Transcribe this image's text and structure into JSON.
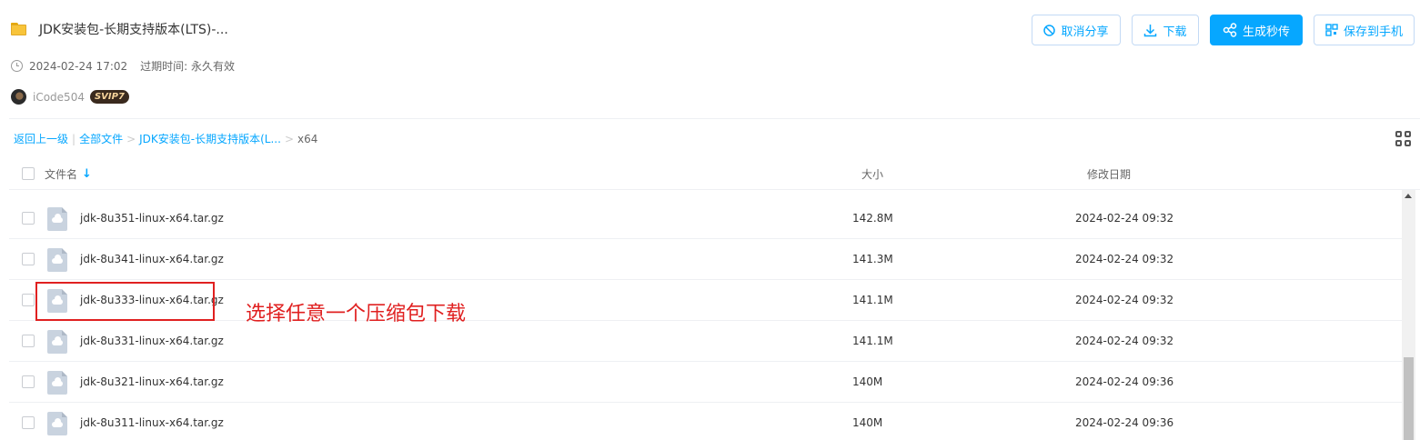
{
  "share": {
    "title": "JDK安装包-长期支持版本(LTS)-...",
    "datetime": "2024-02-24 17:02",
    "expire_label": "过期时间: 永久有效",
    "username": "iCode504",
    "vip": "SVIP7"
  },
  "actions": {
    "cancel_share": "取消分享",
    "download": "下载",
    "generate": "生成秒传",
    "save_phone": "保存到手机"
  },
  "breadcrumb": {
    "back": "返回上一级",
    "all_files": "全部文件",
    "folder": "JDK安装包-长期支持版本(L...",
    "current": "x64"
  },
  "table": {
    "col_name": "文件名",
    "col_size": "大小",
    "col_date": "修改日期",
    "rows": [
      {
        "name": "jdk-8u351-linux-x64.tar.gz",
        "size": "142.8M",
        "date": "2024-02-24 09:32"
      },
      {
        "name": "jdk-8u341-linux-x64.tar.gz",
        "size": "141.3M",
        "date": "2024-02-24 09:32"
      },
      {
        "name": "jdk-8u333-linux-x64.tar.gz",
        "size": "141.1M",
        "date": "2024-02-24 09:32"
      },
      {
        "name": "jdk-8u331-linux-x64.tar.gz",
        "size": "141.1M",
        "date": "2024-02-24 09:32"
      },
      {
        "name": "jdk-8u321-linux-x64.tar.gz",
        "size": "140M",
        "date": "2024-02-24 09:36"
      },
      {
        "name": "jdk-8u311-linux-x64.tar.gz",
        "size": "140M",
        "date": "2024-02-24 09:36"
      }
    ]
  },
  "annotation": "选择任意一个压缩包下载",
  "colors": {
    "accent": "#06a7ff",
    "annotation": "#e02020"
  }
}
